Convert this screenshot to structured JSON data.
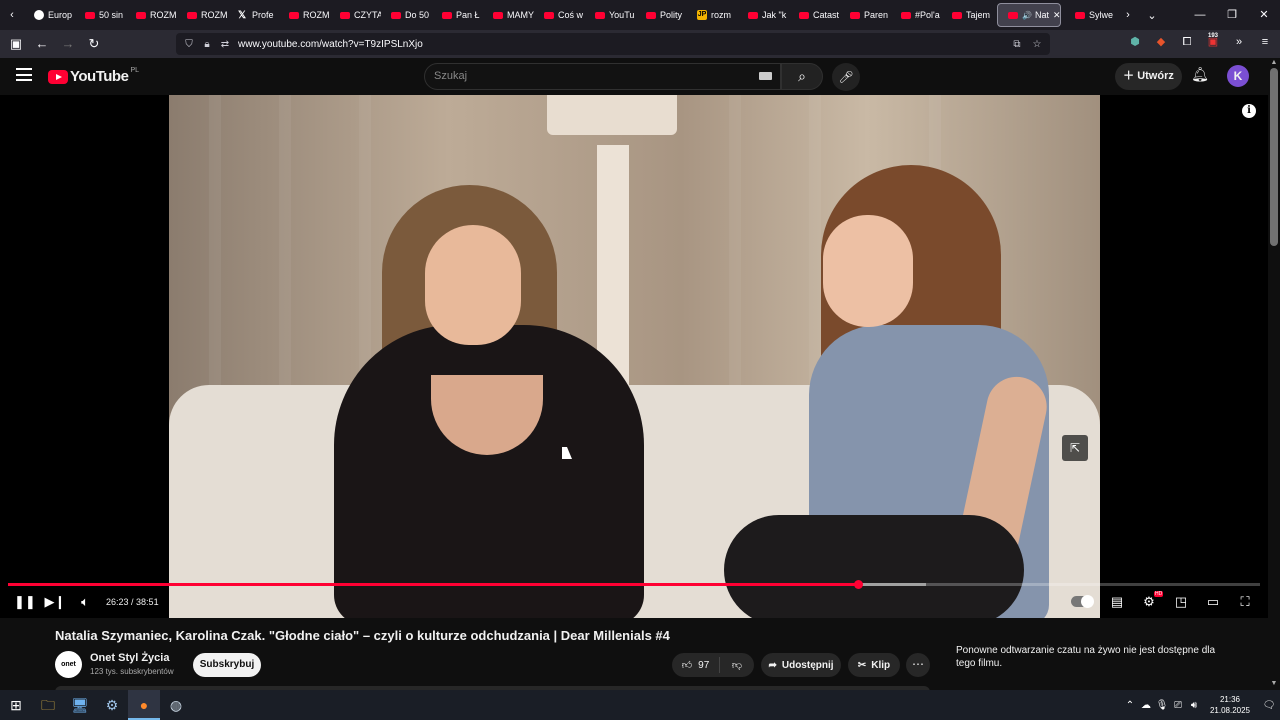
{
  "browser": {
    "tabs": [
      {
        "label": "Europ",
        "favicon": "globe-icon"
      },
      {
        "label": "50 sin",
        "favicon": "youtube-icon"
      },
      {
        "label": "ROZM",
        "favicon": "youtube-icon"
      },
      {
        "label": "ROZM",
        "favicon": "youtube-icon"
      },
      {
        "label": "Profe",
        "favicon": "x-icon"
      },
      {
        "label": "ROZM",
        "favicon": "youtube-icon"
      },
      {
        "label": "CZYTA",
        "favicon": "youtube-icon"
      },
      {
        "label": "Do 50",
        "favicon": "youtube-icon"
      },
      {
        "label": "Pan Ł",
        "favicon": "youtube-icon"
      },
      {
        "label": "MAMY",
        "favicon": "youtube-icon"
      },
      {
        "label": "Coś w",
        "favicon": "youtube-icon"
      },
      {
        "label": "YouTu",
        "favicon": "youtube-icon"
      },
      {
        "label": "Polity",
        "favicon": "youtube-icon"
      },
      {
        "label": "rozm",
        "favicon": "jp-icon"
      },
      {
        "label": "Jak \"k",
        "favicon": "youtube-icon"
      },
      {
        "label": "Catast",
        "favicon": "youtube-icon"
      },
      {
        "label": "Paren",
        "favicon": "youtube-icon"
      },
      {
        "label": "#Pol'a",
        "favicon": "youtube-icon"
      },
      {
        "label": "Tajem",
        "favicon": "youtube-icon"
      }
    ],
    "active_tab": {
      "label": "Nat",
      "favicon": "youtube-icon"
    },
    "after_tabs": [
      {
        "label": "Sylwe",
        "favicon": "youtube-icon"
      }
    ],
    "url": "www.youtube.com/watch?v=T9zIPSLnXjo",
    "extension_badge": "193"
  },
  "youtube": {
    "logo_text": "YouTube",
    "region": "PL",
    "search_placeholder": "Szukaj",
    "create_label": "Utwórz",
    "avatar_letter": "K"
  },
  "player": {
    "current_time": "26:23",
    "duration": "38:51",
    "progress_fraction": 0.679,
    "buffered_fraction": 0.733,
    "hd_badge": "HD"
  },
  "video": {
    "title": "Natalia Szymaniec, Karolina Czak. \"Głodne ciało\" – czyli o kulturze odchudzania | Dear Millenials #4",
    "channel_name": "Onet Styl Życia",
    "channel_logo_text": "onet",
    "subscribers": "123 tys. subskrybentów",
    "subscribe_label": "Subskrybuj",
    "likes": "97",
    "share_label": "Udostępnij",
    "clip_label": "Klip"
  },
  "chat_replay_message": "Ponowne odtwarzanie czatu na żywo nie jest dostępne dla tego filmu.",
  "taskbar": {
    "time": "21:36",
    "date": "21.08.2025"
  },
  "colors": {
    "accent": "#ff0033",
    "background": "#0f0f0f"
  }
}
